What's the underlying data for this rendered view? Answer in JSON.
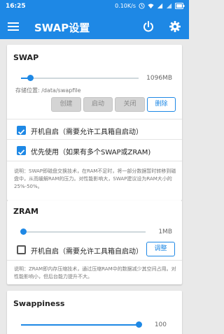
{
  "status_bar": {
    "time": "16:25",
    "net_speed": "0.10K/s",
    "icons": [
      "clock-icon",
      "wifi-icon",
      "signal-icon",
      "signal-icon",
      "battery-icon"
    ]
  },
  "app_bar": {
    "title": "SWAP设置",
    "icons": [
      "menu-icon",
      "power-icon",
      "gear-icon"
    ]
  },
  "swap": {
    "title": "SWAP",
    "size_value": "1096MB",
    "size_level": 0.08,
    "path": "存储位置: /data/swapfile",
    "buttons": {
      "create": "创建",
      "start": "启动",
      "stop": "关闭",
      "delete": "删除"
    },
    "checkbox_autostart": {
      "label": "开机自启（需要允许工具箱自启动）",
      "checked": true
    },
    "checkbox_priority": {
      "label": "优先使用（如果有多个SWAP或ZRAM)",
      "checked": true
    },
    "note": "说明：SWAP即磁盘交换技术，在RAM不足时，将一部分数据暂时转移到磁盘中，从而缓解RAM的压力。对性能影响大，SWAP建议设为RAM大小的25%-50%。"
  },
  "zram": {
    "title": "ZRAM",
    "size_value": "1MB",
    "size_level": 0.02,
    "checkbox_autostart": {
      "label": "开机自启（需要允许工具箱自启动）",
      "checked": false
    },
    "adjust_button": "调整",
    "note": "说明：ZRAM即内存压缩技术，通过压缩RAM中的数据减少其空间占用。对性能影响小，但后台能力提升不大。"
  },
  "swappiness": {
    "title": "Swappiness",
    "value": "100",
    "level": 1.0
  },
  "colors": {
    "accent": "#1e88e5",
    "background": "#e9e9e9",
    "card": "#ffffff"
  }
}
